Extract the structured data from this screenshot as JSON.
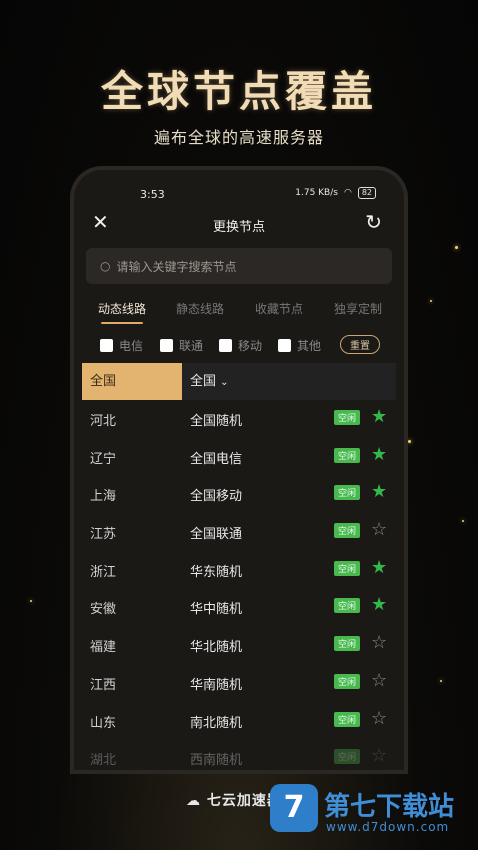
{
  "hero": {
    "title": "全球节点覆盖",
    "subtitle": "遍布全球的高速服务器"
  },
  "status": {
    "time": "3:53",
    "speed": "1.75 KB/s",
    "battery": "82"
  },
  "header": {
    "title": "更换节点"
  },
  "search": {
    "placeholder": "请输入关键字搜索节点"
  },
  "tabs": [
    "动态线路",
    "静态线路",
    "收藏节点",
    "独享定制"
  ],
  "filters": {
    "options": [
      "电信",
      "联通",
      "移动",
      "其他"
    ],
    "reset": "重置"
  },
  "list": {
    "selected_province": "全国",
    "node_dropdown": "全国",
    "badge": "空闲",
    "rows": [
      {
        "province": "河北",
        "node": "全国随机",
        "favorite": true
      },
      {
        "province": "辽宁",
        "node": "全国电信",
        "favorite": true
      },
      {
        "province": "上海",
        "node": "全国移动",
        "favorite": true
      },
      {
        "province": "江苏",
        "node": "全国联通",
        "favorite": false
      },
      {
        "province": "浙江",
        "node": "华东随机",
        "favorite": true
      },
      {
        "province": "安徽",
        "node": "华中随机",
        "favorite": true
      },
      {
        "province": "福建",
        "node": "华北随机",
        "favorite": false
      },
      {
        "province": "江西",
        "node": "华南随机",
        "favorite": false
      },
      {
        "province": "山东",
        "node": "南北随机",
        "favorite": false
      },
      {
        "province": "湖北",
        "node": "西南随机",
        "favorite": false
      }
    ]
  },
  "brand": "七云加速器",
  "watermark": {
    "title": "第七下载站",
    "url": "www.d7down.com"
  },
  "colors": {
    "accent": "#e3b370",
    "badge": "#49b84e",
    "star_on": "#34b84a"
  }
}
